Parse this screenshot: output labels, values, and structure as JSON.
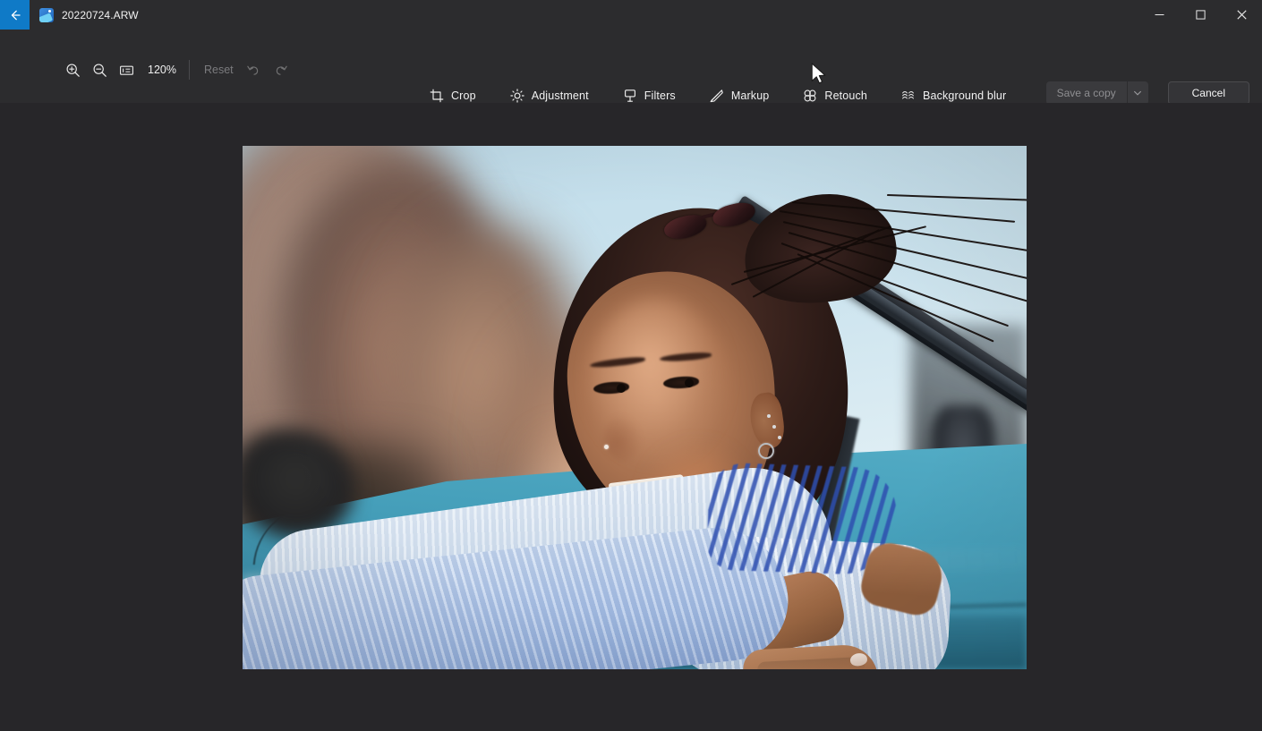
{
  "window": {
    "back_button": "back-arrow",
    "app_icon": "photos-app-icon",
    "file_title": "20220724.ARW",
    "controls": {
      "minimize": "minimize",
      "maximize": "maximize",
      "close": "close"
    }
  },
  "toolbar": {
    "zoom_in": "zoom-in",
    "zoom_out": "zoom-out",
    "fit_to_screen": "fit-to-screen",
    "zoom_level": "120%",
    "reset_label": "Reset",
    "undo": "undo",
    "redo": "redo",
    "edit_tools": [
      {
        "label": "Crop",
        "icon": "crop-icon"
      },
      {
        "label": "Adjustment",
        "icon": "brightness-icon"
      },
      {
        "label": "Filters",
        "icon": "filter-icon"
      },
      {
        "label": "Markup",
        "icon": "pen-icon"
      },
      {
        "label": "Retouch",
        "icon": "retouch-icon"
      },
      {
        "label": "Background blur",
        "icon": "blur-icon"
      }
    ],
    "save_copy_label": "Save a copy",
    "save_copy_chevron": "chevron-down-icon",
    "cancel_label": "Cancel"
  },
  "colors": {
    "accent": "#0f7ac7",
    "app_background": "#272629",
    "toolbar_background": "#2c2c2e",
    "text_primary": "#f2f2f2",
    "text_disabled": "#7b7b7e"
  },
  "photo": {
    "description": "Smiling woman with dark hair leaning on the turquoise body of a convertible car, light blue sky and blurred warm rocks behind her",
    "zoom_applied": "120%"
  }
}
